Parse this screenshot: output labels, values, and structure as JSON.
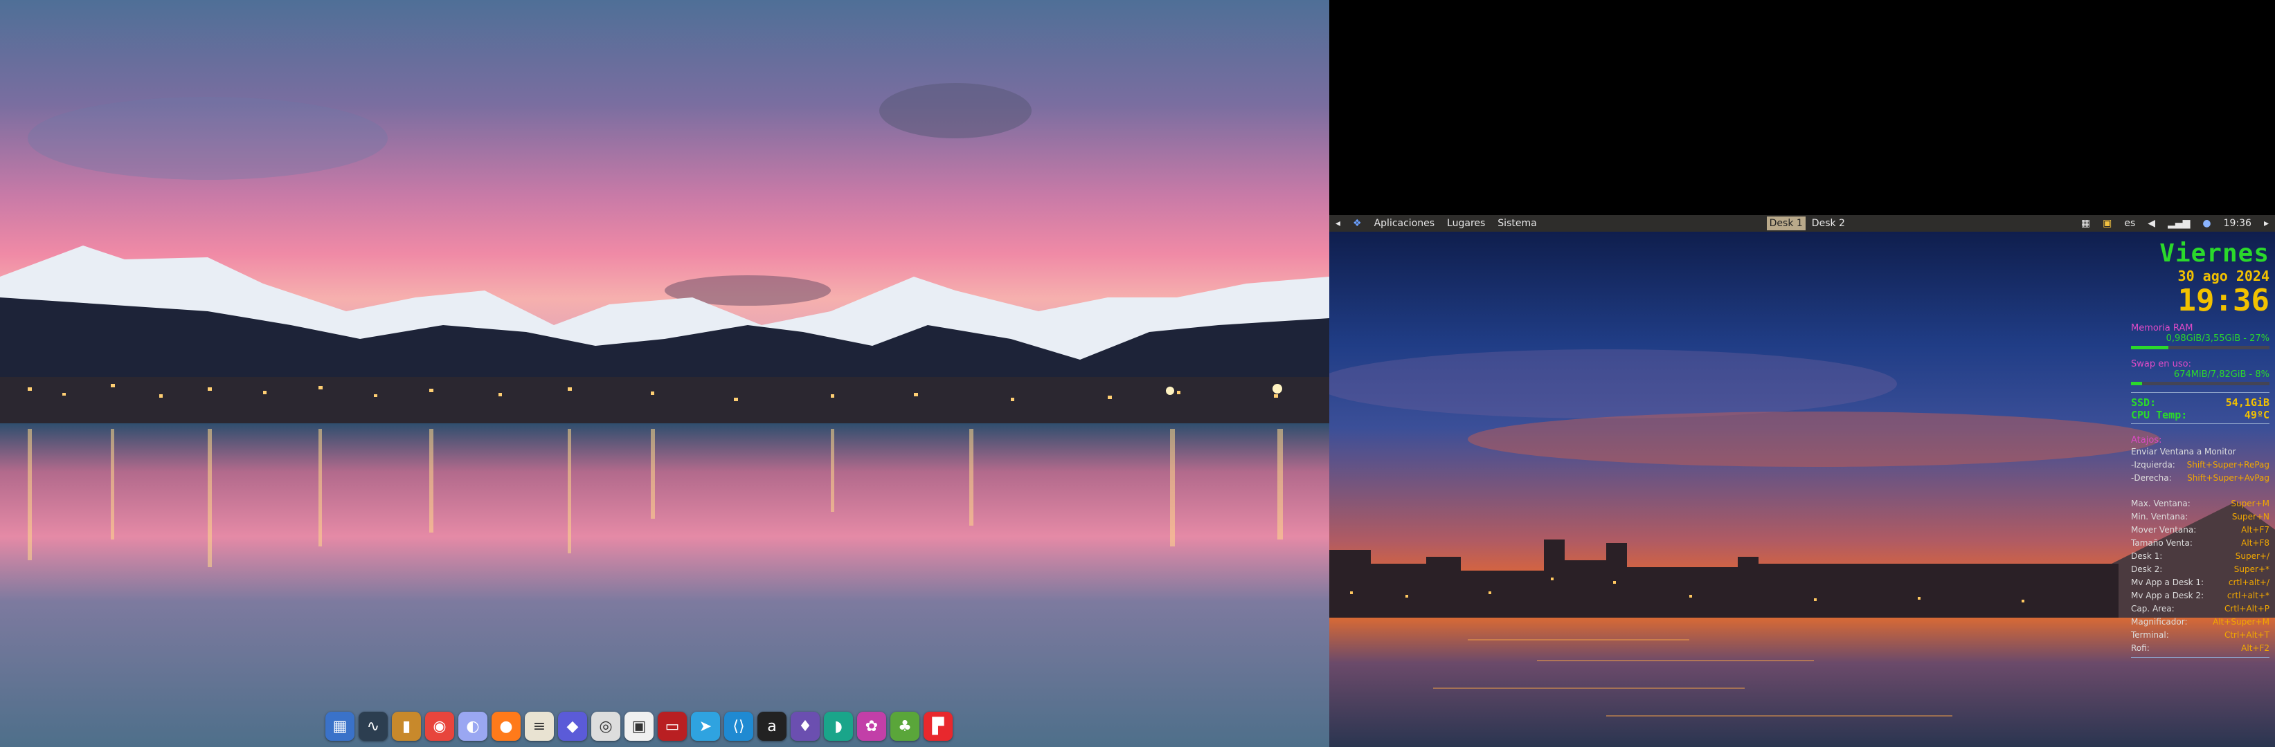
{
  "panel": {
    "menus": [
      "Aplicaciones",
      "Lugares",
      "Sistema"
    ],
    "workspaces": [
      "Desk 1",
      "Desk 2"
    ],
    "active_workspace": 0,
    "keyboard_layout": "es",
    "clock": "19:36"
  },
  "conky": {
    "day": "Viernes",
    "date": "30 ago 2024",
    "time": "19:36",
    "ram": {
      "label": "Memoria RAM",
      "value": "0,98GiB/3,55GiB - 27%",
      "percent": 27
    },
    "swap": {
      "label": "Swap en uso:",
      "value": "674MiB/7,82GiB - 8%",
      "percent": 8
    },
    "ssd": {
      "label": "SSD:",
      "value": "54,1GiB"
    },
    "cpu": {
      "label": "CPU Temp:",
      "value": "49ºC"
    },
    "shortcuts_title": "Atajos:",
    "send_window_label": "Enviar Ventana a Monitor",
    "shortcuts": [
      {
        "key": "-Izquierda:",
        "value": "Shift+Super+RePag"
      },
      {
        "key": "-Derecha:",
        "value": "Shift+Super+AvPag"
      },
      {
        "key": "Max. Ventana:",
        "value": "Super+M"
      },
      {
        "key": "Min. Ventana:",
        "value": "Super+N"
      },
      {
        "key": "Mover Ventana:",
        "value": "Alt+F7"
      },
      {
        "key": "Tamaño Venta:",
        "value": "Alt+F8"
      },
      {
        "key": "Desk 1:",
        "value": "Super+/"
      },
      {
        "key": "Desk 2:",
        "value": "Super+*"
      },
      {
        "key": "Mv App a Desk 1:",
        "value": "crtl+alt+/"
      },
      {
        "key": "Mv App a Desk 2:",
        "value": "crtl+alt+*"
      },
      {
        "key": "Cap. Area:",
        "value": "Crtl+Alt+P"
      },
      {
        "key": "Magnificador:",
        "value": "Alt+Super+M"
      },
      {
        "key": "Terminal:",
        "value": "Ctrl+Alt+T"
      },
      {
        "key": "Rofi:",
        "value": "Alt+F2"
      }
    ]
  },
  "dock": {
    "icons": [
      {
        "name": "system-monitor-icon",
        "color": "#3a72c9",
        "glyph": "▦"
      },
      {
        "name": "activity-monitor-icon",
        "color": "#2c3e50",
        "glyph": "∿"
      },
      {
        "name": "archive-icon",
        "color": "#c8892b",
        "glyph": "▮"
      },
      {
        "name": "chrome-icon",
        "color": "#e8453c",
        "glyph": "◉"
      },
      {
        "name": "browser-icon",
        "color": "#9aa7f2",
        "glyph": "◐"
      },
      {
        "name": "firefox-icon",
        "color": "#ff7a1a",
        "glyph": "●"
      },
      {
        "name": "text-editor-icon",
        "color": "#e9e3d2",
        "glyph": "≡"
      },
      {
        "name": "diamond-app-icon",
        "color": "#5b5bd8",
        "glyph": "◆"
      },
      {
        "name": "webcam-icon",
        "color": "#dddddd",
        "glyph": "◎"
      },
      {
        "name": "package-icon",
        "color": "#f0f0f0",
        "glyph": "▣"
      },
      {
        "name": "terminal-app-icon",
        "color": "#b91f22",
        "glyph": "▭"
      },
      {
        "name": "telegram-icon",
        "color": "#2fa3e0",
        "glyph": "➤"
      },
      {
        "name": "vscode-icon",
        "color": "#1f8ad2",
        "glyph": "⟨⟩"
      },
      {
        "name": "amazon-icon",
        "color": "#222222",
        "glyph": "a"
      },
      {
        "name": "crystal-app-icon",
        "color": "#6b4fb0",
        "glyph": "♦"
      },
      {
        "name": "teal-app-icon",
        "color": "#1aa58a",
        "glyph": "◗"
      },
      {
        "name": "flower-app-icon",
        "color": "#c23fa8",
        "glyph": "✿"
      },
      {
        "name": "green-app-icon",
        "color": "#5aa63a",
        "glyph": "♣"
      },
      {
        "name": "flipboard-icon",
        "color": "#e8282d",
        "glyph": "▛"
      }
    ]
  }
}
